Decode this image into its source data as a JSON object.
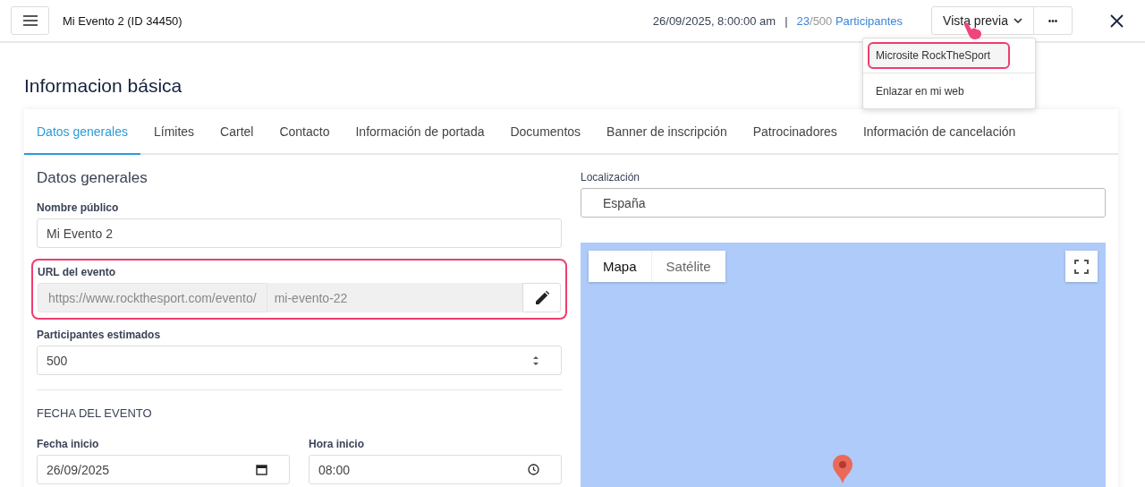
{
  "header": {
    "event_title": "Mi Evento 2 (ID 34450)",
    "datetime": "26/09/2025, 8:00:00 am",
    "separator": "|",
    "registered": "23",
    "capacity": "/500",
    "participants_label": "Participantes",
    "preview_button": "Vista previa",
    "more_button": "•••"
  },
  "preview_menu": {
    "items": [
      {
        "label": "Microsite RockTheSport",
        "highlighted": true
      },
      {
        "label": "Enlazar en mi web",
        "highlighted": false
      }
    ]
  },
  "page_title": "Informacion básica",
  "tabs": [
    {
      "label": "Datos generales",
      "selected": true
    },
    {
      "label": "Límites",
      "selected": false
    },
    {
      "label": "Cartel",
      "selected": false
    },
    {
      "label": "Contacto",
      "selected": false
    },
    {
      "label": "Información de portada",
      "selected": false
    },
    {
      "label": "Documentos",
      "selected": false
    },
    {
      "label": "Banner de inscripción",
      "selected": false
    },
    {
      "label": "Patrocinadores",
      "selected": false
    },
    {
      "label": "Información de cancelación",
      "selected": false
    }
  ],
  "section_title": "Datos generales",
  "public_name": {
    "label": "Nombre público",
    "value": "Mi Evento 2"
  },
  "event_url": {
    "label": "URL del evento",
    "prefix": "https://www.rockthesport.com/evento/",
    "slug": "mi-evento-22",
    "highlighted": true
  },
  "estimated_participants": {
    "label": "Participantes estimados",
    "value": "500"
  },
  "date_section": "FECHA DEL EVENTO",
  "start_date": {
    "label": "Fecha inicio",
    "value": "26/09/2025"
  },
  "start_time": {
    "label": "Hora inicio",
    "value": "08:00"
  },
  "location": {
    "label": "Localización",
    "value": "España"
  },
  "map": {
    "tabs": [
      {
        "label": "Mapa",
        "selected": true
      },
      {
        "label": "Satélite",
        "selected": false
      }
    ]
  }
}
